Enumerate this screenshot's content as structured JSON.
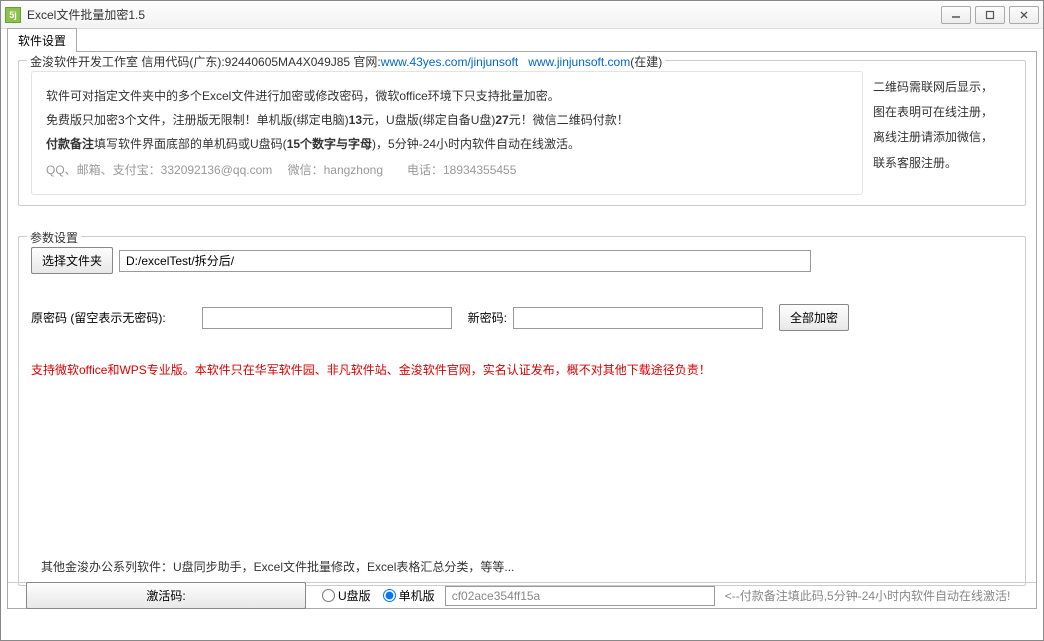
{
  "window": {
    "title": "Excel文件批量加密1.5",
    "icon_letter": "5j"
  },
  "tabs": {
    "settings": "软件设置"
  },
  "fieldset1": {
    "legend_prefix": "金浚软件开发工作室 信用代码(广东):92440605MA4X049J85 官网:",
    "url1": "www.43yes.com/jinjunsoft",
    "url2": "www.jinjunsoft.com",
    "url2_suffix": "(在建)",
    "line1": "软件可对指定文件夹中的多个Excel文件进行加密或修改密码，微软office环境下只支持批量加密。",
    "line2_a": "免费版只加密3个文件，注册版无限制！单机版(绑定电脑)",
    "line2_price1": "13",
    "line2_b": "元，U盘版(绑定自备U盘)",
    "line2_price2": "27",
    "line2_c": "元！微信二维码付款！",
    "line3_a": "付款备注",
    "line3_b": "填写软件界面底部的单机码或U盘码(",
    "line3_c": "15个数字与字母",
    "line3_d": ")，5分钟-24小时内软件自动在线激活。",
    "contact": "QQ、邮箱、支付宝：332092136@qq.com　 微信：hangzhong　　电话：18934355455",
    "right1": "二维码需联网后显示，",
    "right2": "图在表明可在线注册，",
    "right3": "离线注册请添加微信，",
    "right4": "联系客服注册。"
  },
  "params": {
    "legend": "参数设置",
    "select_folder_btn": "选择文件夹",
    "folder_path": "D:/excelTest/拆分后/",
    "old_pwd_label": "原密码 (留空表示无密码):",
    "new_pwd_label": "新密码:",
    "encrypt_all_btn": "全部加密",
    "red_note": "支持微软office和WPS专业版。本软件只在华军软件园、非凡软件站、金浚软件官网，实名认证发布，概不对其他下载途径负责！",
    "other_software": "其他金浚办公系列软件：U盘同步助手，Excel文件批量修改，Excel表格汇总分类，等等..."
  },
  "footer": {
    "activation_btn": "激活码:",
    "radio_usb": "U盘版",
    "radio_single": "单机版",
    "machine_code": "cf02ace354ff15a",
    "hint": "<--付款备注填此码,5分钟-24小时内软件自动在线激活!"
  }
}
